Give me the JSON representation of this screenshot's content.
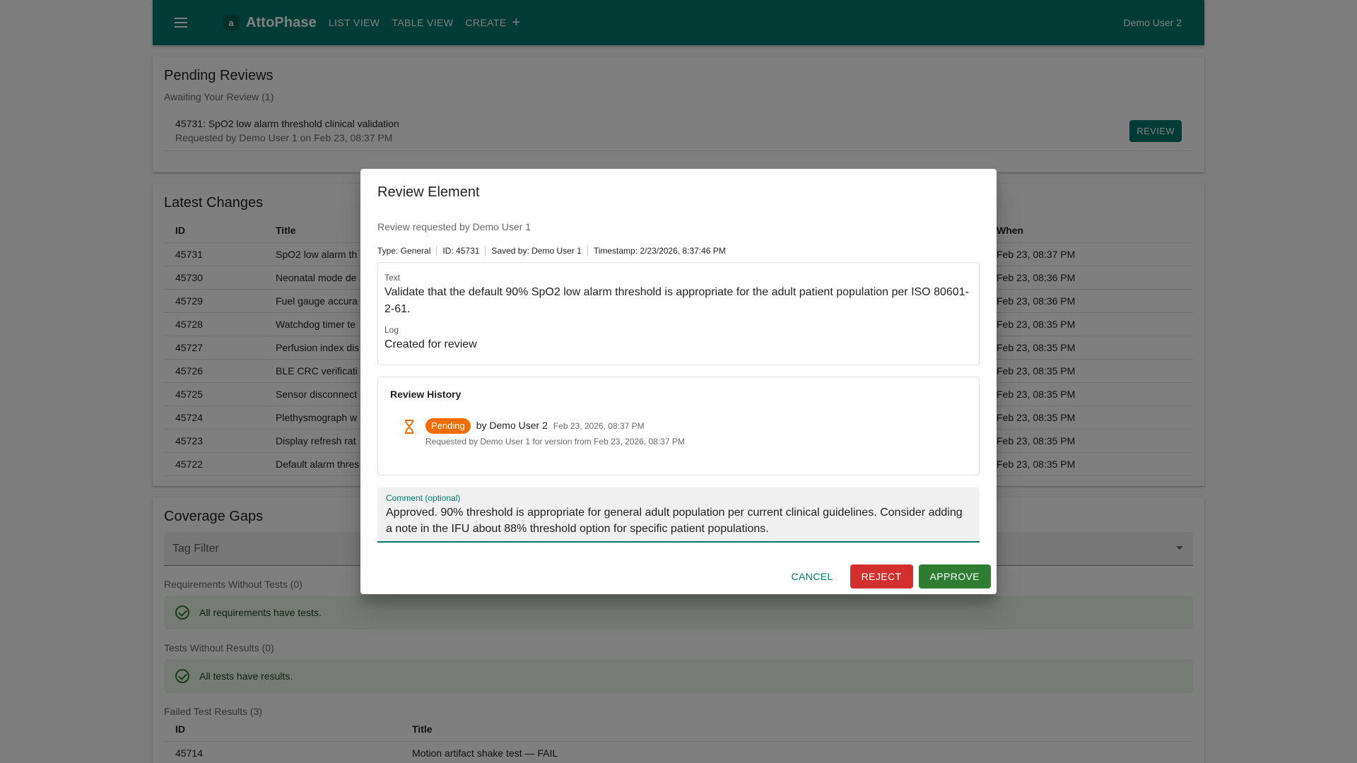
{
  "appbar": {
    "brand": "AttoPhase",
    "logo_letter": "a",
    "nav": [
      "LIST VIEW",
      "TABLE VIEW",
      "CREATE"
    ],
    "user": "Demo User 2"
  },
  "pending": {
    "title": "Pending Reviews",
    "subtitle": "Awaiting Your Review (1)",
    "item_title": "45731: SpO2 low alarm threshold clinical validation",
    "item_sub": "Requested by Demo User 1 on Feb 23, 08:37 PM",
    "button": "REVIEW"
  },
  "changes": {
    "title": "Latest Changes",
    "columns": [
      "ID",
      "Title",
      "When"
    ],
    "rows": [
      [
        "45731",
        "SpO2 low alarm th",
        "Feb 23, 08:37 PM"
      ],
      [
        "45730",
        "Neonatal mode de",
        "Feb 23, 08:36 PM"
      ],
      [
        "45729",
        "Fuel gauge accura",
        "Feb 23, 08:36 PM"
      ],
      [
        "45728",
        "Watchdog timer te",
        "Feb 23, 08:35 PM"
      ],
      [
        "45727",
        "Perfusion index dis",
        "Feb 23, 08:35 PM"
      ],
      [
        "45726",
        "BLE CRC verificati",
        "Feb 23, 08:35 PM"
      ],
      [
        "45725",
        "Sensor disconnect",
        "Feb 23, 08:35 PM"
      ],
      [
        "45724",
        "Plethysmograph w",
        "Feb 23, 08:35 PM"
      ],
      [
        "45723",
        "Display refresh rat",
        "Feb 23, 08:35 PM"
      ],
      [
        "45722",
        "Default alarm thres",
        "Feb 23, 08:35 PM"
      ]
    ]
  },
  "coverage": {
    "title": "Coverage Gaps",
    "tag_filter": "Tag Filter",
    "req_label": "Requirements Without Tests (0)",
    "req_alert": "All requirements have tests.",
    "tests_label": "Tests Without Results (0)",
    "tests_alert": "All tests have results.",
    "failed_label": "Failed Test Results (3)",
    "failed_columns": [
      "ID",
      "Title"
    ],
    "failed_rows": [
      [
        "45714",
        "Motion artifact shake test — FAIL"
      ]
    ]
  },
  "dialog": {
    "title": "Review Element",
    "requested_by": "Review requested by Demo User 1",
    "meta": {
      "type": "Type: General",
      "id": "ID: 45731",
      "saved_by": "Saved by: Demo User 1",
      "timestamp": "Timestamp: 2/23/2026, 8:37:46 PM"
    },
    "text_label": "Text",
    "text_value": "Validate that the default 90% SpO2 low alarm threshold is appropriate for the adult patient population per ISO 80601-2-61.",
    "log_label": "Log",
    "log_value": "Created for review",
    "history": {
      "title": "Review History",
      "status": "Pending",
      "by": "by Demo User 2",
      "date": "Feb 23, 2026, 08:37 PM",
      "requested": "Requested by Demo User 1 for version from Feb 23, 2026, 08:37 PM"
    },
    "comment_label": "Comment (optional)",
    "comment_value": "Approved. 90% threshold is appropriate for general adult population per current clinical guidelines. Consider adding a note in the IFU about 88% threshold option for specific patient populations.",
    "buttons": {
      "cancel": "CANCEL",
      "reject": "REJECT",
      "approve": "APPROVE"
    }
  },
  "colors": {
    "primary": "#00796b",
    "reject": "#d32f2f",
    "approve": "#2e7d32",
    "pending": "#ef6c00"
  }
}
